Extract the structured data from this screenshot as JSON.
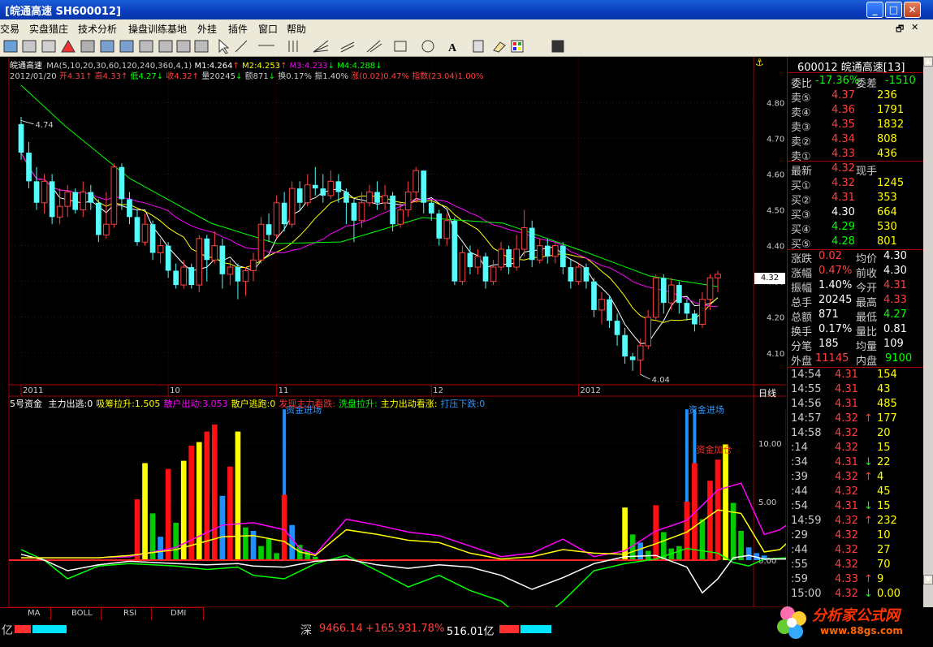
{
  "window": {
    "title": "[皖通高速 SH600012]"
  },
  "menu": [
    "交易",
    "实盘猎庄",
    "技术分析",
    "操盘训练基地",
    "外挂",
    "插件",
    "窗口",
    "帮助"
  ],
  "chart": {
    "info1": {
      "name": "皖通高速",
      "ma": "MA(5,10,20,30,60,120,240,360,4,1)",
      "m1": "M1:4.264",
      "m2": "M2:4.253",
      "m3": "M3:4.233",
      "m4": "M4:4.288"
    },
    "info2": {
      "date": "2012/01/20",
      "open": "开4.31",
      "high": "高4.33",
      "low": "低4.27",
      "close": "收4.32",
      "vol": "量20245",
      "amt": "额871",
      "turn": "换0.17%",
      "amp": "振1.40%",
      "chg": "涨(0.02)0.47%",
      "idx": "指数(23.04)1.00%"
    },
    "price_axis": [
      "4.80",
      "4.70",
      "4.60",
      "4.50",
      "4.40",
      "4.30",
      "4.20",
      "4.10"
    ],
    "high_label": "4.74",
    "low_label": "4.04",
    "cur_label": "4.32",
    "xaxis": [
      "2011",
      "10",
      "11",
      "12",
      "2012"
    ],
    "period": "日线",
    "indicator": {
      "name": "5号资金",
      "items": [
        {
          "t": "主力出逃:0",
          "c": "#ffffff"
        },
        {
          "t": "吸筹拉升:1.505",
          "c": "#ffff00"
        },
        {
          "t": "散户出动:3.053",
          "c": "#ff00ff"
        },
        {
          "t": "散户逃跑:0",
          "c": "#ffff00"
        },
        {
          "t": "发现主力看跌:",
          "c": "#ff3030"
        },
        {
          "t": "洗盘拉升:",
          "c": "#00ff00"
        },
        {
          "t": "主力出动看涨:",
          "c": "#ffff00"
        },
        {
          "t": "打压下跌:0",
          "c": "#3399ff"
        }
      ]
    },
    "ind_axis": [
      "10.00",
      "5.00",
      "0.00"
    ],
    "labels": {
      "inflow": "资金进场",
      "warehouse": "资金加仓"
    }
  },
  "chart_data": {
    "type": "candlestick",
    "ylim": [
      4.02,
      4.86
    ],
    "candles": [
      [
        4.74,
        4.66,
        4.76,
        4.64
      ],
      [
        4.66,
        4.58,
        4.69,
        4.56
      ],
      [
        4.58,
        4.52,
        4.62,
        4.5
      ],
      [
        4.52,
        4.58,
        4.6,
        4.49
      ],
      [
        4.58,
        4.48,
        4.6,
        4.46
      ],
      [
        4.48,
        4.51,
        4.56,
        4.46
      ],
      [
        4.51,
        4.55,
        4.57,
        4.48
      ],
      [
        4.55,
        4.5,
        4.56,
        4.49
      ],
      [
        4.5,
        4.55,
        4.58,
        4.48
      ],
      [
        4.55,
        4.52,
        4.57,
        4.5
      ],
      [
        4.52,
        4.43,
        4.53,
        4.41
      ],
      [
        4.43,
        4.46,
        4.55,
        4.42
      ],
      [
        4.46,
        4.62,
        4.63,
        4.45
      ],
      [
        4.62,
        4.53,
        4.63,
        4.5
      ],
      [
        4.53,
        4.48,
        4.55,
        4.46
      ],
      [
        4.48,
        4.41,
        4.5,
        4.4
      ],
      [
        4.41,
        4.46,
        4.49,
        4.4
      ],
      [
        4.46,
        4.38,
        4.47,
        4.36
      ],
      [
        4.38,
        4.4,
        4.42,
        4.35
      ],
      [
        4.4,
        4.33,
        4.41,
        4.31
      ],
      [
        4.33,
        4.29,
        4.35,
        4.28
      ],
      [
        4.29,
        4.34,
        4.36,
        4.28
      ],
      [
        4.34,
        4.29,
        4.35,
        4.28
      ],
      [
        4.29,
        4.42,
        4.43,
        4.27
      ],
      [
        4.42,
        4.36,
        4.43,
        4.3
      ],
      [
        4.36,
        4.4,
        4.44,
        4.35
      ],
      [
        4.4,
        4.32,
        4.42,
        4.28
      ],
      [
        4.32,
        4.34,
        4.36,
        4.29
      ],
      [
        4.34,
        4.3,
        4.35,
        4.25
      ],
      [
        4.3,
        4.33,
        4.34,
        4.26
      ],
      [
        4.33,
        4.36,
        4.38,
        4.3
      ],
      [
        4.36,
        4.46,
        4.48,
        4.35
      ],
      [
        4.46,
        4.43,
        4.49,
        4.41
      ],
      [
        4.43,
        4.52,
        4.54,
        4.42
      ],
      [
        4.52,
        4.46,
        4.55,
        4.44
      ],
      [
        4.46,
        4.56,
        4.58,
        4.45
      ],
      [
        4.56,
        4.52,
        4.58,
        4.5
      ],
      [
        4.52,
        4.57,
        4.6,
        4.51
      ],
      [
        4.57,
        4.56,
        4.62,
        4.54
      ],
      [
        4.56,
        4.54,
        4.6,
        4.52
      ],
      [
        4.54,
        4.58,
        4.61,
        4.53
      ],
      [
        4.58,
        4.55,
        4.6,
        4.52
      ],
      [
        4.55,
        4.52,
        4.56,
        4.46
      ],
      [
        4.52,
        4.47,
        4.53,
        4.41
      ],
      [
        4.47,
        4.52,
        4.55,
        4.45
      ],
      [
        4.52,
        4.55,
        4.57,
        4.51
      ],
      [
        4.55,
        4.52,
        4.58,
        4.5
      ],
      [
        4.52,
        4.54,
        4.57,
        4.5
      ],
      [
        4.54,
        4.46,
        4.55,
        4.44
      ],
      [
        4.46,
        4.5,
        4.52,
        4.45
      ],
      [
        4.5,
        4.55,
        4.58,
        4.48
      ],
      [
        4.55,
        4.61,
        4.62,
        4.52
      ],
      [
        4.61,
        4.52,
        4.61,
        4.49
      ],
      [
        4.52,
        4.49,
        4.53,
        4.47
      ],
      [
        4.49,
        4.42,
        4.5,
        4.4
      ],
      [
        4.42,
        4.47,
        4.49,
        4.4
      ],
      [
        4.47,
        4.3,
        4.48,
        4.29
      ],
      [
        4.3,
        4.38,
        4.4,
        4.29
      ],
      [
        4.38,
        4.34,
        4.4,
        4.32
      ],
      [
        4.34,
        4.37,
        4.39,
        4.32
      ],
      [
        4.37,
        4.3,
        4.38,
        4.28
      ],
      [
        4.3,
        4.34,
        4.36,
        4.29
      ],
      [
        4.34,
        4.39,
        4.41,
        4.33
      ],
      [
        4.39,
        4.34,
        4.4,
        4.32
      ],
      [
        4.34,
        4.39,
        4.43,
        4.33
      ],
      [
        4.39,
        4.45,
        4.5,
        4.37
      ],
      [
        4.45,
        4.36,
        4.47,
        4.34
      ],
      [
        4.36,
        4.4,
        4.42,
        4.35
      ],
      [
        4.4,
        4.37,
        4.42,
        4.35
      ],
      [
        4.37,
        4.4,
        4.41,
        4.35
      ],
      [
        4.4,
        4.34,
        4.41,
        4.32
      ],
      [
        4.34,
        4.3,
        4.36,
        4.28
      ],
      [
        4.3,
        4.34,
        4.35,
        4.29
      ],
      [
        4.34,
        4.3,
        4.35,
        4.28
      ],
      [
        4.3,
        4.22,
        4.31,
        4.2
      ],
      [
        4.22,
        4.25,
        4.27,
        4.18
      ],
      [
        4.25,
        4.19,
        4.26,
        4.17
      ],
      [
        4.19,
        4.15,
        4.21,
        4.12
      ],
      [
        4.15,
        4.09,
        4.17,
        4.07
      ],
      [
        4.09,
        4.08,
        4.1,
        4.05
      ],
      [
        4.08,
        4.12,
        4.14,
        4.04
      ],
      [
        4.12,
        4.2,
        4.22,
        4.11
      ],
      [
        4.2,
        4.31,
        4.32,
        4.19
      ],
      [
        4.31,
        4.24,
        4.32,
        4.21
      ],
      [
        4.24,
        4.29,
        4.31,
        4.22
      ],
      [
        4.29,
        4.24,
        4.3,
        4.21
      ],
      [
        4.24,
        4.21,
        4.25,
        4.19
      ],
      [
        4.21,
        4.18,
        4.22,
        4.16
      ],
      [
        4.18,
        4.25,
        4.27,
        4.17
      ],
      [
        4.25,
        4.31,
        4.32,
        4.22
      ],
      [
        4.31,
        4.32,
        4.33,
        4.27
      ]
    ],
    "volume_bars": [
      {
        "i": 15,
        "v": 5.2,
        "c": "#ff1010"
      },
      {
        "i": 16,
        "v": 8.3,
        "c": "#ffff00"
      },
      {
        "i": 17,
        "v": 4.0,
        "c": "#00cc00"
      },
      {
        "i": 18,
        "v": 2.0,
        "c": "#1e90ff"
      },
      {
        "i": 19,
        "v": 7.8,
        "c": "#ff1010"
      },
      {
        "i": 20,
        "v": 3.2,
        "c": "#00cc00"
      },
      {
        "i": 21,
        "v": 8.5,
        "c": "#ffff00"
      },
      {
        "i": 22,
        "v": 9.8,
        "c": "#ff1010"
      },
      {
        "i": 23,
        "v": 10.1,
        "c": "#ffff00"
      },
      {
        "i": 24,
        "v": 11.0,
        "c": "#ff1010"
      },
      {
        "i": 25,
        "v": 11.6,
        "c": "#ff1010"
      },
      {
        "i": 26,
        "v": 5.5,
        "c": "#1e90ff"
      },
      {
        "i": 27,
        "v": 8.0,
        "c": "#ff1010"
      },
      {
        "i": 28,
        "v": 11.0,
        "c": "#ffff00"
      },
      {
        "i": 29,
        "v": 2.8,
        "c": "#00cc00"
      },
      {
        "i": 30,
        "v": 2.5,
        "c": "#1e90ff"
      },
      {
        "i": 31,
        "v": 1.2,
        "c": "#00cc00"
      },
      {
        "i": 32,
        "v": 1.8,
        "c": "#00cc00"
      },
      {
        "i": 33,
        "v": 0.6,
        "c": "#00cc00"
      },
      {
        "i": 34,
        "v": 5.6,
        "c": "#ff1010"
      },
      {
        "i": 35,
        "v": 3.0,
        "c": "#1e90ff"
      },
      {
        "i": 36,
        "v": 1.3,
        "c": "#00cc00"
      },
      {
        "i": 37,
        "v": 0.8,
        "c": "#00cc00"
      },
      {
        "i": 38,
        "v": 0.3,
        "c": "#00cc00"
      },
      {
        "i": 78,
        "v": 4.5,
        "c": "#ffff00"
      },
      {
        "i": 79,
        "v": 2.2,
        "c": "#00cc00"
      },
      {
        "i": 80,
        "v": 1.5,
        "c": "#1e90ff"
      },
      {
        "i": 81,
        "v": 0.8,
        "c": "#00cc00"
      },
      {
        "i": 82,
        "v": 4.7,
        "c": "#ff1010"
      },
      {
        "i": 83,
        "v": 2.4,
        "c": "#00cc00"
      },
      {
        "i": 84,
        "v": 1.0,
        "c": "#00cc00"
      },
      {
        "i": 85,
        "v": 1.2,
        "c": "#00cc00"
      },
      {
        "i": 86,
        "v": 5.0,
        "c": "#ff1010"
      },
      {
        "i": 87,
        "v": 8.3,
        "c": "#ff1010"
      },
      {
        "i": 88,
        "v": 3.5,
        "c": "#00cc00"
      },
      {
        "i": 89,
        "v": 6.8,
        "c": "#ff1010"
      },
      {
        "i": 90,
        "v": 8.6,
        "c": "#ff1010"
      },
      {
        "i": 91,
        "v": 9.9,
        "c": "#ffff00"
      },
      {
        "i": 92,
        "v": 4.9,
        "c": "#00cc00"
      },
      {
        "i": 93,
        "v": 2.5,
        "c": "#00cc00"
      },
      {
        "i": 94,
        "v": 1.1,
        "c": "#1e90ff"
      },
      {
        "i": 95,
        "v": 0.6,
        "c": "#1e90ff"
      },
      {
        "i": 96,
        "v": 0.4,
        "c": "#1e90ff"
      }
    ],
    "tall_blue": [
      {
        "i": 34,
        "v": 12.9
      },
      {
        "i": 86,
        "v": 12.9
      },
      {
        "i": 87,
        "v": 12.9
      },
      {
        "i": 99,
        "v": 12.9
      }
    ]
  },
  "quote": {
    "header": "600012 皖通高速[13]",
    "weibi": "委比",
    "weibi_v": "-17.36%",
    "weicha": "委差",
    "weicha_v": "-1510",
    "sells": [
      {
        "l": "卖⑤",
        "p": "4.37",
        "v": "236"
      },
      {
        "l": "卖④",
        "p": "4.36",
        "v": "1791"
      },
      {
        "l": "卖③",
        "p": "4.35",
        "v": "1832"
      },
      {
        "l": "卖②",
        "p": "4.34",
        "v": "808"
      },
      {
        "l": "卖①",
        "p": "4.33",
        "v": "436"
      }
    ],
    "latest": "最新",
    "latest_v": "4.32",
    "xianshou": "现手",
    "buys": [
      {
        "l": "买①",
        "p": "4.32",
        "v": "1245"
      },
      {
        "l": "买②",
        "p": "4.31",
        "v": "353"
      },
      {
        "l": "买③",
        "p": "4.30",
        "v": "664"
      },
      {
        "l": "买④",
        "p": "4.29",
        "v": "530"
      },
      {
        "l": "买⑤",
        "p": "4.28",
        "v": "801"
      }
    ],
    "stats": [
      {
        "a": "涨跌",
        "av": "0.02",
        "b": "均价",
        "bv": "4.30"
      },
      {
        "a": "涨幅",
        "av": "0.47%",
        "b": "前收",
        "bv": "4.30"
      },
      {
        "a": "振幅",
        "av": "1.40%",
        "b": "今开",
        "bv": "4.31"
      },
      {
        "a": "总手",
        "av": "20245",
        "b": "最高",
        "bv": "4.33"
      },
      {
        "a": "总额",
        "av": "871",
        "b": "最低",
        "bv": "4.27"
      },
      {
        "a": "换手",
        "av": "0.17%",
        "b": "量比",
        "bv": "0.81"
      },
      {
        "a": "分笔",
        "av": "185",
        "b": "均量",
        "bv": "109"
      }
    ],
    "waipan": "外盘",
    "waipan_v": "11145",
    "neipan": "内盘",
    "neipan_v": "9100",
    "ticks": [
      {
        "t": "14:54",
        "p": "4.31",
        "a": "",
        "v": "154"
      },
      {
        "t": "14:55",
        "p": "4.31",
        "a": "",
        "v": "43"
      },
      {
        "t": "14:56",
        "p": "4.31",
        "a": "",
        "v": "485"
      },
      {
        "t": "14:57",
        "p": "4.32",
        "a": "↑",
        "v": "177"
      },
      {
        "t": "14:58",
        "p": "4.32",
        "a": "",
        "v": "20"
      },
      {
        "t": ":14",
        "p": "4.32",
        "a": "",
        "v": "15"
      },
      {
        "t": ":34",
        "p": "4.31",
        "a": "↓",
        "v": "22"
      },
      {
        "t": ":39",
        "p": "4.32",
        "a": "↑",
        "v": "4"
      },
      {
        "t": ":44",
        "p": "4.32",
        "a": "",
        "v": "45"
      },
      {
        "t": ":54",
        "p": "4.31",
        "a": "↓",
        "v": "15"
      },
      {
        "t": "14:59",
        "p": "4.32",
        "a": "↑",
        "v": "232"
      },
      {
        "t": ":29",
        "p": "4.32",
        "a": "",
        "v": "10"
      },
      {
        "t": ":44",
        "p": "4.32",
        "a": "",
        "v": "27"
      },
      {
        "t": ":55",
        "p": "4.32",
        "a": "",
        "v": "70"
      },
      {
        "t": ":59",
        "p": "4.33",
        "a": "↑",
        "v": "9"
      },
      {
        "t": "15:00",
        "p": "4.32",
        "a": "↓",
        "v": "0.00"
      }
    ]
  },
  "tabs": [
    "MA",
    "BOLL",
    "RSI",
    "DMI"
  ],
  "status": {
    "left": "亿",
    "shen_label": "深",
    "shen_idx": "9466.14",
    "shen_chg": "+165.93",
    "shen_pct": "1.78%",
    "shen_amt": "516.01亿"
  },
  "watermark": {
    "text": "分析家公式网",
    "url": "www.88gs.com"
  }
}
